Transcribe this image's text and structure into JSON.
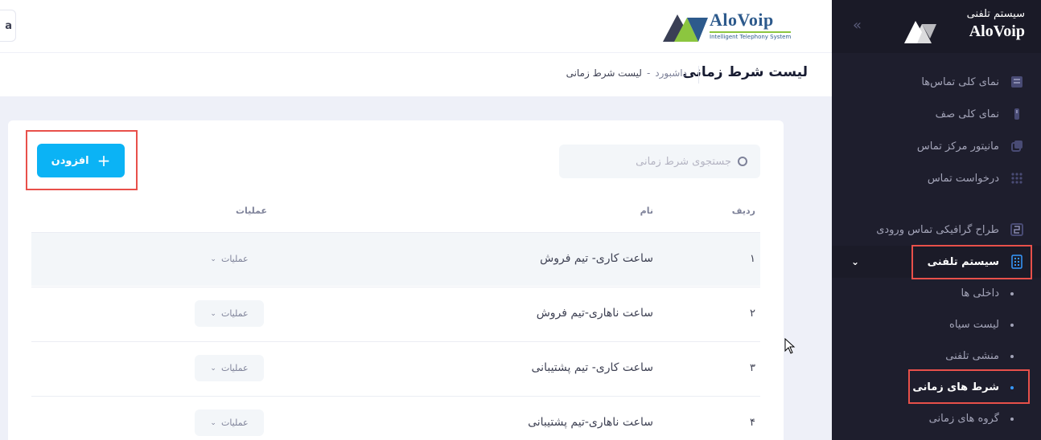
{
  "sidebar": {
    "brand_title": "سیستم تلفنی",
    "brand_name": "AloVoip",
    "collapse_icon": "double-chevron-left-icon",
    "items": [
      {
        "label": "نمای کلی تماس‌ها",
        "icon": "calls-overview-icon"
      },
      {
        "label": "نمای کلی صف",
        "icon": "queue-icon"
      },
      {
        "label": "مانیتور مرکز تماس",
        "icon": "monitor-icon"
      },
      {
        "label": "درخواست تماس",
        "icon": "grid-icon"
      },
      {
        "label": "طراح گرافیکی تماس ورودی",
        "icon": "ivr-designer-icon"
      },
      {
        "label": "سیستم تلفنی",
        "icon": "phone-system-icon",
        "active": true
      }
    ],
    "sub_items": [
      {
        "label": "داخلی ها"
      },
      {
        "label": "لیست سیاه"
      },
      {
        "label": "منشی تلفنی"
      },
      {
        "label": "شرط های زمانی",
        "active": true
      },
      {
        "label": "گروه های زمانی"
      }
    ]
  },
  "header": {
    "logo_name": "AloVoip",
    "logo_tagline": "Intelligent Telephony System",
    "left_button_char": "a"
  },
  "subheader": {
    "title": "لیست شرط زمانی",
    "breadcrumb": [
      "داشبورد",
      "-",
      "لیست شرط زمانی"
    ]
  },
  "toolbar": {
    "add_label": "افزودن",
    "search_placeholder": "جستجوی شرط زمانی"
  },
  "table": {
    "headers": {
      "index": "ردیف",
      "name": "نام",
      "ops": "عملیات"
    },
    "rows": [
      {
        "index": "۱",
        "name": "ساعت کاری- تیم فروش",
        "ops": "عملیات"
      },
      {
        "index": "۲",
        "name": "ساعت ناهاری-تیم فروش",
        "ops": "عملیات"
      },
      {
        "index": "۳",
        "name": "ساعت کاری- تیم پشتیبانی",
        "ops": "عملیات"
      },
      {
        "index": "۴",
        "name": "ساعت ناهاری-تیم پشتیبانی",
        "ops": "عملیات"
      }
    ]
  },
  "colors": {
    "accent": "#0bb3f5",
    "sidebar": "#1e1e2d",
    "highlight": "#e8504a"
  }
}
